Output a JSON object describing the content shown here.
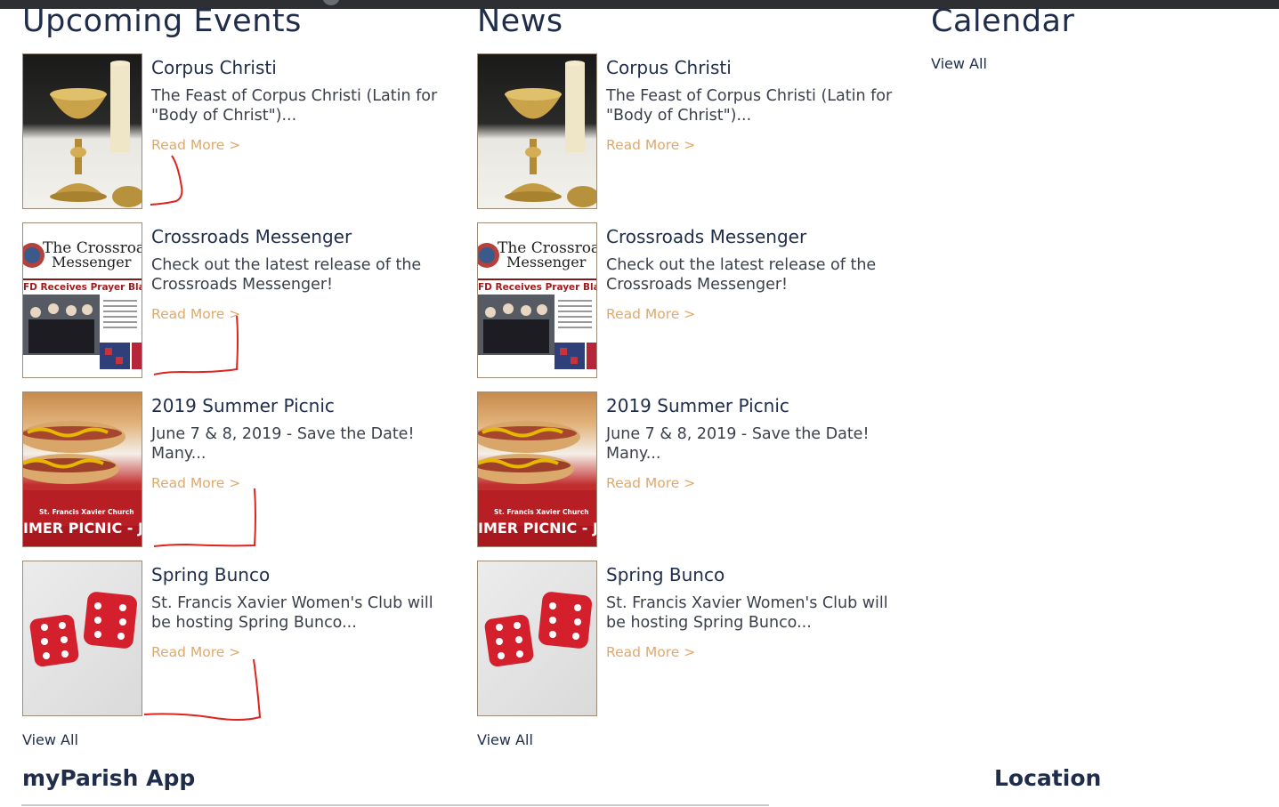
{
  "events": {
    "heading": "Upcoming Events",
    "view_all": "View All",
    "items": [
      {
        "title": "Corpus Christi",
        "desc": "The Feast of Corpus Christi (Latin for \"Body of Christ\")...",
        "read_more": "Read More >"
      },
      {
        "title": "Crossroads Messenger",
        "desc": "Check out the latest release of the Crossroads Messenger!",
        "read_more": "Read More >"
      },
      {
        "title": "2019 Summer Picnic",
        "desc": "June 7 & 8, 2019 - Save the Date! Many...",
        "read_more": "Read More >"
      },
      {
        "title": "Spring Bunco",
        "desc": "St. Francis Xavier Women's Club will be hosting Spring Bunco...",
        "read_more": "Read More >"
      }
    ]
  },
  "news": {
    "heading": "News",
    "view_all": "View All",
    "items": [
      {
        "title": "Corpus Christi",
        "desc": "The Feast of Corpus Christi (Latin for \"Body of Christ\")...",
        "read_more": "Read More >"
      },
      {
        "title": "Crossroads Messenger",
        "desc": "Check out the latest release of the Crossroads Messenger!",
        "read_more": "Read More >"
      },
      {
        "title": "2019 Summer Picnic",
        "desc": "June 7 & 8, 2019 - Save the Date! Many...",
        "read_more": "Read More >"
      },
      {
        "title": "Spring Bunco",
        "desc": "St. Francis Xavier Women's Club will be hosting Spring Bunco...",
        "read_more": "Read More >"
      }
    ]
  },
  "calendar": {
    "heading": "Calendar",
    "view_all": "View All"
  },
  "footer": {
    "app_title": "myParish App",
    "location_title": "Location"
  },
  "thumbnails": {
    "crossroads_masthead_line1": "The Crossroa",
    "crossroads_masthead_line2": "Messenger",
    "crossroads_headline": "FD Receives Prayer Blan",
    "picnic_church": "St. Francis Xavier Church",
    "picnic_banner": "IMER PICNIC - J"
  },
  "colors": {
    "heading": "#1f2d4a",
    "read_more": "#e0a96b",
    "annotation": "#e0231c",
    "topbar": "#2d2f33"
  }
}
